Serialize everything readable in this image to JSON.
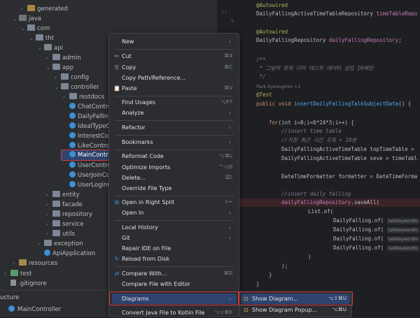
{
  "project_tree": {
    "items": [
      {
        "label": "generated",
        "kind": "gen"
      },
      {
        "label": "java",
        "kind": "folder"
      },
      {
        "label": "com",
        "kind": "pkg"
      },
      {
        "label": "tht",
        "kind": "pkg"
      },
      {
        "label": "api",
        "kind": "pkg"
      },
      {
        "label": "admin",
        "kind": "pkg"
      },
      {
        "label": "app",
        "kind": "pkg"
      },
      {
        "label": "config",
        "kind": "pkg"
      },
      {
        "label": "controller",
        "kind": "pkg"
      },
      {
        "label": "restdocs",
        "kind": "pkg"
      },
      {
        "label": "ChatControlle",
        "kind": "cls"
      },
      {
        "label": "DailyFallingCo",
        "kind": "cls"
      },
      {
        "label": "IdealTypeCon",
        "kind": "cls"
      },
      {
        "label": "InterestContr",
        "kind": "cls"
      },
      {
        "label": "LikeControlle",
        "kind": "cls"
      },
      {
        "label": "MainControlle",
        "kind": "cls"
      },
      {
        "label": "UserControlle",
        "kind": "cls"
      },
      {
        "label": "UserJoinCont",
        "kind": "cls"
      },
      {
        "label": "UserLoginCon",
        "kind": "cls"
      },
      {
        "label": "entity",
        "kind": "pkg"
      },
      {
        "label": "facade",
        "kind": "pkg"
      },
      {
        "label": "repository",
        "kind": "pkg"
      },
      {
        "label": "service",
        "kind": "pkg"
      },
      {
        "label": "utils",
        "kind": "pkg"
      },
      {
        "label": "exception",
        "kind": "pkg"
      },
      {
        "label": "ApiApplication",
        "kind": "cls"
      },
      {
        "label": "resources",
        "kind": "res"
      },
      {
        "label": "test",
        "kind": "test"
      },
      {
        "label": ".gitignore",
        "kind": "file"
      }
    ],
    "structure_label": "ucture",
    "structure_item": "MainController"
  },
  "editor": {
    "line_numbers": [
      "17",
      "18"
    ],
    "lines": {
      "l1_ann": "@Autowired",
      "l2_type": "DailyFallingActiveTimeTableRepository ",
      "l2_field": "timeTableRepo",
      "l3_ann": "@Autowired",
      "l4_type": "DailyFallingRepository ",
      "l4_field": "dailyFallingRepository",
      "l4_end": ";",
      "l5": "/**",
      "l6": " * 그날의 토픽 더미 테스트 데이터 삽입 10배만",
      "l7": " */",
      "l8_hint": "Park ilyeongmin +1",
      "l9_ann": "@Test",
      "l10_kw": "public void ",
      "l10_fn": "insertDailyFallingTalkSubjectData",
      "l10_end": "() {",
      "l11_kw": "for",
      "l11_rest": "(int i=0;i<6*24*3;i++) {",
      "l12": "//insert time table",
      "l13": "//가장 최근 시간 조회 + 10분",
      "l14": "DailyFallingActiveTimeTable topTimeTable = ",
      "l15": "DailyFallingActiveTimeTable seve = timeTabl",
      "l16": "DateTimeFormatter formatter = DateTimeForma",
      "l17": "//insert daily falling",
      "l18_field": "dailyFallingRepository",
      "l18_rest": ".saveAll(",
      "l19": "List.of(",
      "l20": "DailyFalling.of(",
      "l21": "DailyFalling.of(",
      "l22": "DailyFalling.of(",
      "l23": "DailyFalling.of(",
      "inlay": "talkKeywordIn",
      "l24": ")",
      "l25": ");",
      "l26": "}",
      "l27": "}"
    }
  },
  "context_menu": {
    "items": [
      {
        "label": "New",
        "shortcut": "",
        "icon": "",
        "submenu": true
      },
      {
        "label": "Cut",
        "shortcut": "⌘X",
        "icon": "✂"
      },
      {
        "label": "Copy",
        "shortcut": "⌘C",
        "icon": "⎘"
      },
      {
        "label": "Copy Path/Reference...",
        "shortcut": "",
        "icon": ""
      },
      {
        "label": "Paste",
        "shortcut": "⌘V",
        "icon": "📋"
      },
      {
        "label": "Find Usages",
        "shortcut": "⌥F7",
        "icon": ""
      },
      {
        "label": "Analyze",
        "shortcut": "",
        "icon": "",
        "submenu": true
      },
      {
        "label": "Refactor",
        "shortcut": "",
        "icon": "",
        "submenu": true
      },
      {
        "label": "Bookmarks",
        "shortcut": "",
        "icon": "",
        "submenu": true
      },
      {
        "label": "Reformat Code",
        "shortcut": "⌥⌘L",
        "icon": ""
      },
      {
        "label": "Optimize Imports",
        "shortcut": "^⌥O",
        "icon": ""
      },
      {
        "label": "Delete...",
        "shortcut": "⌦",
        "icon": ""
      },
      {
        "label": "Override File Type",
        "shortcut": "",
        "icon": ""
      },
      {
        "label": "Open in Right Split",
        "shortcut": "⇧↩",
        "icon": "⊞"
      },
      {
        "label": "Open In",
        "shortcut": "",
        "icon": "",
        "submenu": true
      },
      {
        "label": "Local History",
        "shortcut": "",
        "icon": "",
        "submenu": true
      },
      {
        "label": "Git",
        "shortcut": "",
        "icon": "",
        "submenu": true
      },
      {
        "label": "Repair IDE on File",
        "shortcut": "",
        "icon": ""
      },
      {
        "label": "Reload from Disk",
        "shortcut": "",
        "icon": "↻"
      },
      {
        "label": "Compare With...",
        "shortcut": "⌘D",
        "icon": "⇄"
      },
      {
        "label": "Compare File with Editor",
        "shortcut": "",
        "icon": ""
      },
      {
        "label": "Diagrams",
        "shortcut": "",
        "icon": "",
        "submenu": true,
        "active": true
      },
      {
        "label": "Convert Java File to Kotlin File",
        "shortcut": "⌥⇧⌘K",
        "icon": ""
      }
    ]
  },
  "diagrams_submenu": {
    "items": [
      {
        "label": "Show Diagram...",
        "shortcut": "⌥⇧⌘U",
        "icon": "⊡"
      },
      {
        "label": "Show Diagram Popup...",
        "shortcut": "⌥⌘U",
        "icon": "⊡"
      }
    ]
  },
  "colors": {
    "accent_selection": "#2e436e",
    "highlight_border": "#d43b3b",
    "panel_bg": "#2b2d30",
    "editor_bg": "#1e1f22"
  }
}
